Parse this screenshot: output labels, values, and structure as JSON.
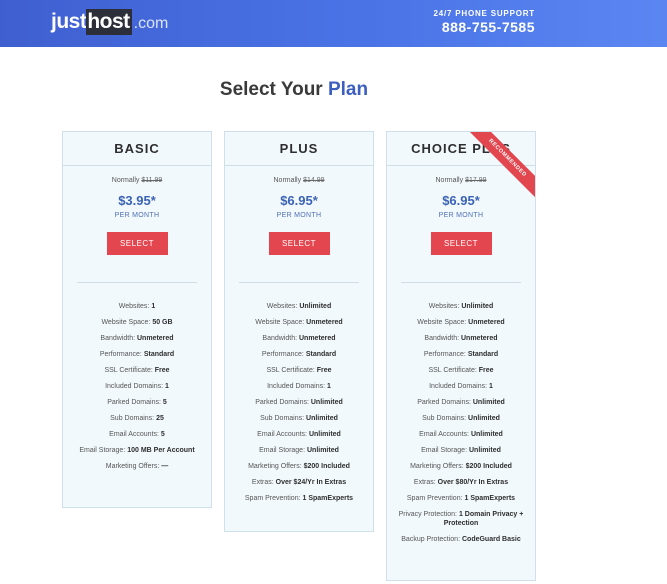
{
  "header": {
    "logo": {
      "just": "just",
      "host": "host",
      "tld": ".com"
    },
    "support_label": "24/7 PHONE SUPPORT",
    "phone": "888-755-7585"
  },
  "heading": {
    "prefix": "Select Your ",
    "accent": "Plan"
  },
  "plans": [
    {
      "name": "BASIC",
      "normally_label": "Normally",
      "normally_price": "$11.99",
      "price": "$3.95*",
      "per": "PER MONTH",
      "button": "SELECT",
      "features": [
        {
          "label": "Websites:",
          "value": "1"
        },
        {
          "label": "Website Space:",
          "value": "50 GB"
        },
        {
          "label": "Bandwidth:",
          "value": "Unmetered"
        },
        {
          "label": "Performance:",
          "value": "Standard"
        },
        {
          "label": "SSL Certificate:",
          "value": "Free"
        },
        {
          "label": "Included Domains:",
          "value": "1"
        },
        {
          "label": "Parked Domains:",
          "value": "5"
        },
        {
          "label": "Sub Domains:",
          "value": "25"
        },
        {
          "label": "Email Accounts:",
          "value": "5"
        },
        {
          "label": "Email Storage:",
          "value": "100 MB Per Account"
        },
        {
          "label": "Marketing Offers:",
          "value": "—"
        }
      ]
    },
    {
      "name": "PLUS",
      "normally_label": "Normally",
      "normally_price": "$14.99",
      "price": "$6.95*",
      "per": "PER MONTH",
      "button": "SELECT",
      "features": [
        {
          "label": "Websites:",
          "value": "Unlimited"
        },
        {
          "label": "Website Space:",
          "value": "Unmetered"
        },
        {
          "label": "Bandwidth:",
          "value": "Unmetered"
        },
        {
          "label": "Performance:",
          "value": "Standard"
        },
        {
          "label": "SSL Certificate:",
          "value": "Free"
        },
        {
          "label": "Included Domains:",
          "value": "1"
        },
        {
          "label": "Parked Domains:",
          "value": "Unlimited"
        },
        {
          "label": "Sub Domains:",
          "value": "Unlimited"
        },
        {
          "label": "Email Accounts:",
          "value": "Unlimited"
        },
        {
          "label": "Email Storage:",
          "value": "Unlimited"
        },
        {
          "label": "Marketing Offers:",
          "value": "$200 Included"
        },
        {
          "label": "Extras:",
          "value": "Over $24/Yr In Extras"
        },
        {
          "label": "Spam Prevention:",
          "value": "1 SpamExperts"
        }
      ]
    },
    {
      "name": "CHOICE PLUS",
      "normally_label": "Normally",
      "normally_price": "$17.99",
      "price": "$6.95*",
      "per": "PER MONTH",
      "button": "SELECT",
      "ribbon": "RECOMMENDED",
      "features": [
        {
          "label": "Websites:",
          "value": "Unlimited"
        },
        {
          "label": "Website Space:",
          "value": "Unmetered"
        },
        {
          "label": "Bandwidth:",
          "value": "Unmetered"
        },
        {
          "label": "Performance:",
          "value": "Standard"
        },
        {
          "label": "SSL Certificate:",
          "value": "Free"
        },
        {
          "label": "Included Domains:",
          "value": "1"
        },
        {
          "label": "Parked Domains:",
          "value": "Unlimited"
        },
        {
          "label": "Sub Domains:",
          "value": "Unlimited"
        },
        {
          "label": "Email Accounts:",
          "value": "Unlimited"
        },
        {
          "label": "Email Storage:",
          "value": "Unlimited"
        },
        {
          "label": "Marketing Offers:",
          "value": "$200 Included"
        },
        {
          "label": "Extras:",
          "value": "Over $80/Yr In Extras"
        },
        {
          "label": "Spam Prevention:",
          "value": "1 SpamExperts"
        },
        {
          "label": "Privacy Protection:",
          "value": "1 Domain Privacy + Protection"
        },
        {
          "label": "Backup Protection:",
          "value": "CodeGuard Basic"
        }
      ]
    }
  ]
}
